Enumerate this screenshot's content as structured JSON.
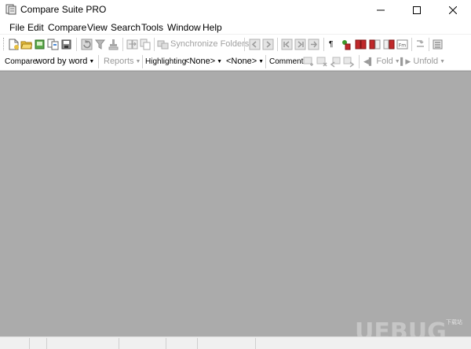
{
  "window": {
    "title": "Compare Suite PRO",
    "minimize_icon": "minimize-icon",
    "maximize_icon": "maximize-icon",
    "close_icon": "close-icon"
  },
  "menu": {
    "items": [
      "File",
      "Edit",
      "Compare",
      "View",
      "Search",
      "Tools",
      "Window",
      "Help"
    ]
  },
  "toolbar": {
    "synchronize_folders": "Synchronize Folders"
  },
  "options_bar": {
    "compare_label": "Compare",
    "compare_mode": "word by word",
    "reports_label": "Reports",
    "highlighting_label": "Highlighting",
    "highlighting_left": "<None>",
    "highlighting_right": "<None>",
    "comments_label": "Comments",
    "fold_label": "Fold",
    "unfold_label": "Unfold"
  },
  "watermark": {
    "text": "UEBUG",
    "subtext": "下载站"
  },
  "colors": {
    "workspace": "#ababab",
    "toolbar_bg": "#ffffff",
    "disabled_text": "#a0a0a0",
    "accent_red": "#c0282a",
    "accent_green": "#3a9a2a",
    "accent_yellow": "#e8c040"
  }
}
